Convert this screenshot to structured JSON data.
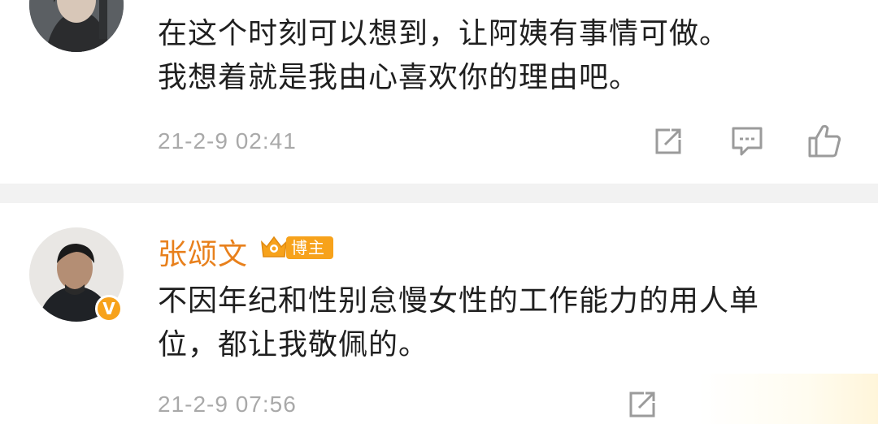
{
  "comments": [
    {
      "text_line1": "在这个时刻可以想到，让阿姨有事情可做。",
      "text_line2": "我想着就是我由心喜欢你的理由吧。",
      "time": "21-2-9 02:41",
      "actions": [
        "forward-icon",
        "comment-icon",
        "like-icon"
      ]
    },
    {
      "username": "张颂文",
      "badge_label": "博主",
      "verified_mark": "V",
      "text_line1": "不因年纪和性别怠慢女性的工作能力的用人单",
      "text_line2": "位，都让我敬佩的。",
      "time": "21-2-9 07:56",
      "actions": [
        "forward-icon"
      ]
    }
  ],
  "colors": {
    "username": "#e8801c",
    "badge": "#f7a21b",
    "timestamp": "#a9a9a9",
    "text": "#1f1f1f",
    "divider": "#f2f2f2"
  }
}
